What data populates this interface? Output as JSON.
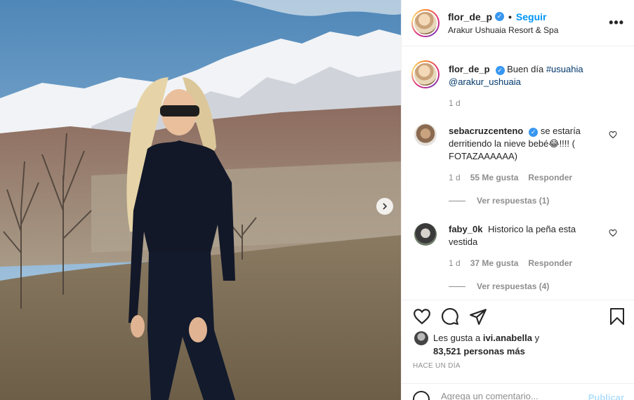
{
  "post": {
    "username": "flor_de_p",
    "follow_label": "Seguir",
    "separator": "•",
    "location": "Arakur Ushuaia Resort & Spa",
    "more_label": "•••"
  },
  "caption": {
    "username": "flor_de_p",
    "text": "Buen día",
    "hashtag": "#usuahia",
    "mention": "@arakur_ushuaia",
    "time": "1 d"
  },
  "comments": [
    {
      "username": "sebacruzcenteno",
      "verified": true,
      "text": "se estaría derritiendo la nieve bebé😂!!!! ( FOTAZAAAAAA)",
      "time": "1 d",
      "likes": "55 Me gusta",
      "reply": "Responder",
      "view_replies": "Ver respuestas (1)"
    },
    {
      "username": "faby_0k",
      "verified": false,
      "text": "Historico la peña esta vestida",
      "time": "1 d",
      "likes": "37 Me gusta",
      "reply": "Responder",
      "view_replies": "Ver respuestas (4)"
    }
  ],
  "likes": {
    "line1_prefix": "Les gusta a",
    "line1_user": "ivi.anabella",
    "line1_suffix": "y",
    "count": "83,521",
    "line2_suffix": "personas más"
  },
  "time_ago": "HACE UN DÍA",
  "add_comment": {
    "placeholder": "Agrega un comentario...",
    "publish_label": "Publicar"
  },
  "colors": {
    "link": "#0095f6",
    "verified": "#3897f0",
    "muted": "#8e8e8e",
    "publish_disabled": "#b2dffc"
  },
  "icons": {
    "verified": "verified-badge-icon",
    "more": "more-options-icon",
    "like": "heart-icon",
    "comment": "comment-icon",
    "share": "share-icon",
    "save": "bookmark-icon",
    "emoji": "emoji-icon",
    "next": "chevron-right-icon"
  }
}
